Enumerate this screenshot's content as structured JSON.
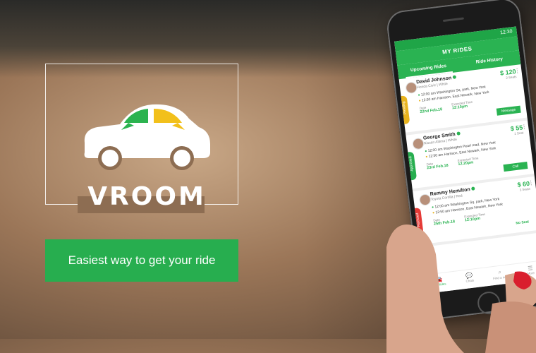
{
  "colors": {
    "brand_green": "#27ae4f",
    "accent_yellow": "#e8b31e",
    "white": "#ffffff"
  },
  "brand": {
    "name": "VROOM"
  },
  "cta": {
    "label": "Easiest way to get your ride"
  },
  "phone": {
    "status_time": "12:30",
    "app_title": "MY RIDES",
    "tabs": [
      {
        "label": "Upcoming Rides",
        "active": true
      },
      {
        "label": "Ride History",
        "active": false
      }
    ],
    "rides": [
      {
        "name": "David Johnson",
        "car": "Honda Civic | White",
        "price": "$ 120",
        "seats": "2 Seats",
        "from": "12:00 am  Washington Sq. park, New York",
        "to": "12:50 am  Harrison, East Newark, New York",
        "date_label": "Date",
        "date": "22nd Feb.18",
        "time_label": "Expected Time",
        "time": "12:10pm",
        "status": "Pending",
        "status_color": "#e8b31e",
        "action": "Message"
      },
      {
        "name": "George Smith",
        "car": "Nissan Altima | White",
        "price": "$ 55",
        "seats": "1 Seat",
        "from": "12:00 am  Washington Pearl road, New York",
        "to": "12:50 am  Harrison, East Newark, New York",
        "date_label": "Date",
        "date": "23rd Feb.18",
        "time_label": "Expected Time",
        "time": "12.20pm",
        "status": "Approved",
        "status_color": "#27ae4f",
        "action": "Call"
      },
      {
        "name": "Remmy Hemilton",
        "car": "Toyota Corolla | Red",
        "price": "$ 60",
        "seats": "3 Seats",
        "from": "12:00 am  Washington Sq. park, New York",
        "to": "12:50 am  Harrison, East Newark, New York",
        "date_label": "Date",
        "date": "25th Feb.18",
        "time_label": "Expected Time",
        "time": "12:10pm",
        "status": "Rejected",
        "status_color": "#e53935",
        "action": "No Seat"
      }
    ],
    "nav": [
      {
        "label": "My Rides",
        "icon": "car-icon",
        "active": true
      },
      {
        "label": "Chats",
        "icon": "chat-icon",
        "active": false
      },
      {
        "label": "Find a ride",
        "icon": "search-icon",
        "active": false
      },
      {
        "label": "More",
        "icon": "menu-icon",
        "active": false
      }
    ]
  }
}
